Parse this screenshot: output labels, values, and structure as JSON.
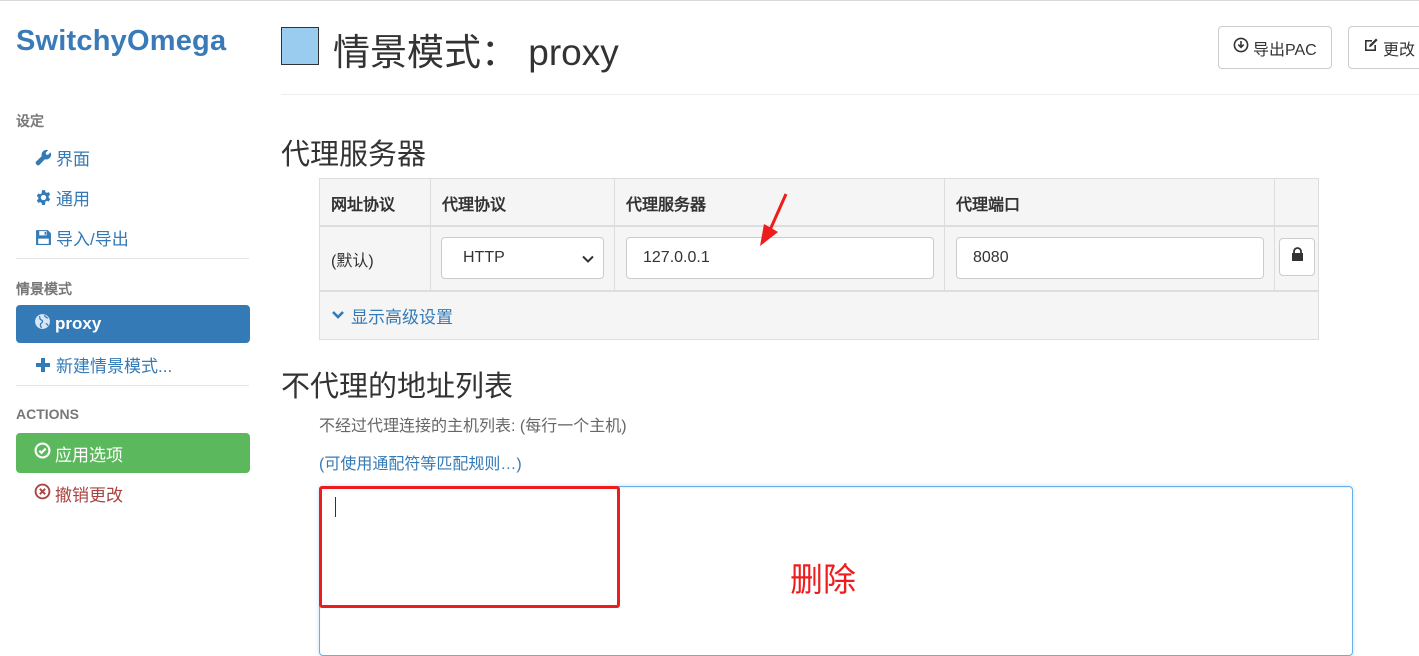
{
  "sidebar": {
    "brand": "SwitchyOmega",
    "settings_header": "设定",
    "settings_items": [
      {
        "label": "界面",
        "icon": "wrench-icon"
      },
      {
        "label": "通用",
        "icon": "gear-icon"
      },
      {
        "label": "导入/导出",
        "icon": "floppy-icon"
      }
    ],
    "profiles_header": "情景模式",
    "active_profile": {
      "label": "proxy",
      "icon": "globe-icon"
    },
    "new_profile": {
      "label": "新建情景模式...",
      "icon": "plus-icon"
    },
    "actions_header": "ACTIONS",
    "apply": {
      "label": "应用选项",
      "icon": "check-circle-icon"
    },
    "revert": {
      "label": "撤销更改",
      "icon": "x-circle-icon"
    }
  },
  "header": {
    "title": "情景模式： proxy",
    "profile_color": "#99ccee",
    "export_pac": "导出PAC",
    "rename": "更改"
  },
  "proxy_section": {
    "title": "代理服务器",
    "columns": [
      "网址协议",
      "代理协议",
      "代理服务器",
      "代理端口"
    ],
    "row": {
      "scheme": "(默认)",
      "protocol": "HTTP",
      "server": "127.0.0.1",
      "port": "8080"
    },
    "advanced_link": "显示高级设置"
  },
  "bypass_section": {
    "title": "不代理的地址列表",
    "help": "不经过代理连接的主机列表: (每行一个主机)",
    "wildcard_link": "(可使用通配符等匹配规则…)",
    "value": ""
  },
  "annotation": {
    "text": "删除",
    "color": "#ee1c1c"
  },
  "colors": {
    "primary": "#337ab7",
    "success": "#5cb85c",
    "danger": "#a94442"
  }
}
